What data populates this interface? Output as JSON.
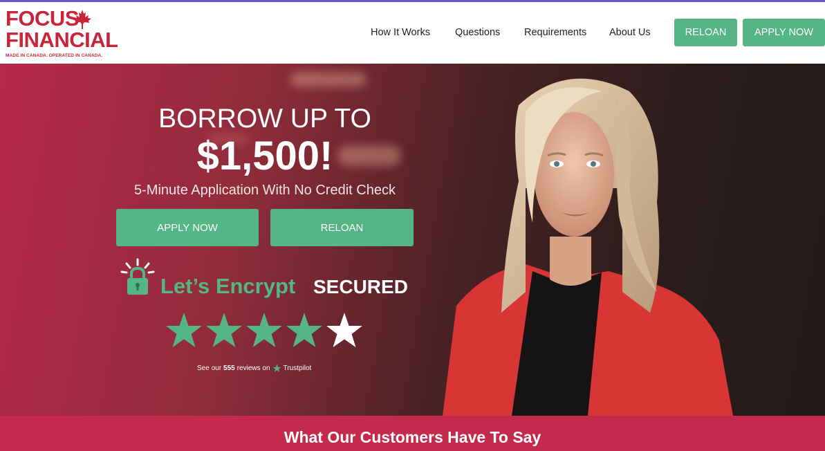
{
  "brand": {
    "line1": "FOCUS",
    "line2": "FINANCIAL",
    "tagline": "MADE IN CANADA. OPERATED IN CANADA.",
    "logo_icon": "maple-leaf-icon",
    "color": "#c8243b"
  },
  "nav": {
    "items": [
      "How It Works",
      "Questions",
      "Requirements",
      "About Us"
    ],
    "reloan_label": "RELOAN",
    "apply_label": "APPLY NOW"
  },
  "hero": {
    "headline_1": "BORROW UP TO",
    "headline_2": "$1,500!",
    "subheadline": "5-Minute Application With No Credit Check",
    "apply_label": "APPLY NOW",
    "reloan_label": "RELOAN",
    "security": {
      "icon": "lock-icon",
      "brand": "Let’s Encrypt",
      "label": "SECURED"
    },
    "rating": {
      "stars": 4.5,
      "max": 5,
      "reviews_prefix": "See our",
      "reviews_count": "555",
      "reviews_suffix": "reviews on",
      "platform": "Trustpilot"
    }
  },
  "testimonials": {
    "title": "What Our Customers Have To Say"
  },
  "colors": {
    "accent_green": "#55b585",
    "brand_red": "#c8243b",
    "band_red": "#c42a4b"
  }
}
